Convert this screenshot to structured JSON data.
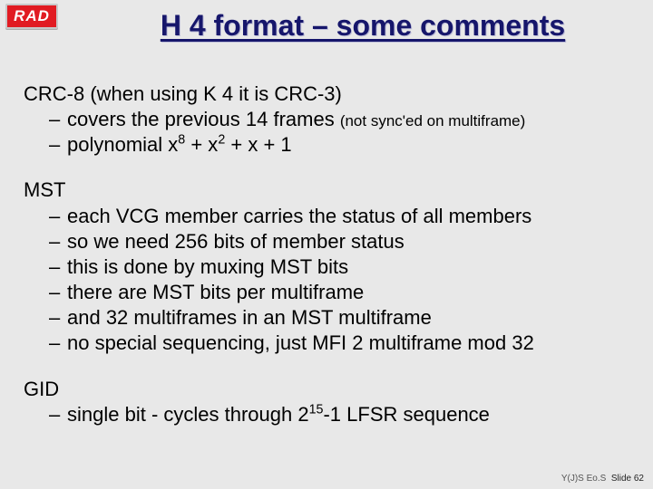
{
  "logo": "RAD",
  "title": "H 4 format – some comments",
  "sections": [
    {
      "head_pre": "CRC-8 (when using K 4 it is CRC-3)",
      "bullets": [
        {
          "pre": "covers the previous 14 frames ",
          "small": "(not sync'ed on multiframe)"
        },
        {
          "pre": "polynomial x",
          "sup1": "8",
          "mid1": " + x",
          "sup2": "2",
          "mid2": " + x + 1"
        }
      ]
    },
    {
      "head_pre": "MST",
      "bullets": [
        {
          "pre": "each VCG member carries the status of all members"
        },
        {
          "pre": "so we need 256 bits of member status"
        },
        {
          "pre": "this is done by muxing MST bits"
        },
        {
          "pre": "there are MST bits per multiframe"
        },
        {
          "pre": "and 32 multiframes in an MST multiframe"
        },
        {
          "pre": "no special sequencing, just MFI 2 multiframe mod 32"
        }
      ]
    },
    {
      "head_pre": "GID",
      "bullets": [
        {
          "pre": "single bit - cycles through 2",
          "sup1": "15",
          "mid1": "-1 LFSR sequence"
        }
      ]
    }
  ],
  "footer": {
    "left": "Y(J)S Eo.S",
    "right": "Slide 62"
  }
}
